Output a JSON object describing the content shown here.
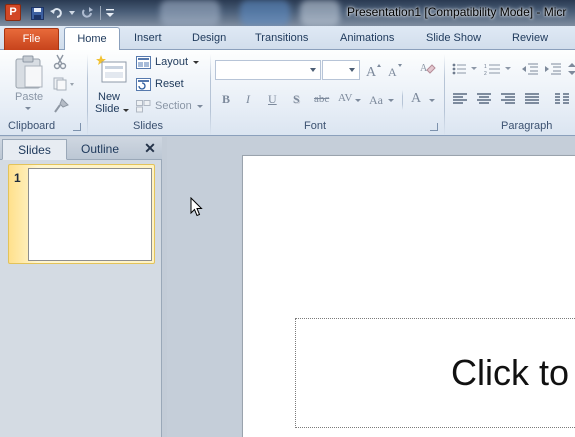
{
  "window": {
    "app_icon_letter": "P",
    "title": "Presentation1 [Compatibility Mode]  -  Micr"
  },
  "quick_access": [
    "save-icon",
    "undo-icon",
    "redo-icon",
    "customize-icon"
  ],
  "tabs": {
    "file": "File",
    "items": [
      "Home",
      "Insert",
      "Design",
      "Transitions",
      "Animations",
      "Slide Show",
      "Review"
    ],
    "active": "Home"
  },
  "ribbon": {
    "clipboard": {
      "label": "Clipboard",
      "paste": "Paste"
    },
    "slides": {
      "label": "Slides",
      "new_slide_line1": "New",
      "new_slide_line2": "Slide",
      "layout": "Layout",
      "reset": "Reset",
      "section": "Section"
    },
    "font": {
      "label": "Font",
      "font_name": "",
      "font_size": "",
      "bold": "B",
      "italic": "I",
      "underline": "U",
      "shadow": "S",
      "strikethrough": "abc",
      "char_spacing": "AV",
      "change_case": "Aa",
      "font_color": "A"
    },
    "paragraph": {
      "label": "Paragraph"
    }
  },
  "panel": {
    "tab_slides": "Slides",
    "tab_outline": "Outline",
    "close": "✕",
    "thumbnails": [
      {
        "number": "1"
      }
    ]
  },
  "slide": {
    "placeholder_text": "Click to"
  },
  "colors": {
    "file_tab": "#d24726",
    "ribbon_text": "#1e395b",
    "selection": "#ffe08c"
  }
}
